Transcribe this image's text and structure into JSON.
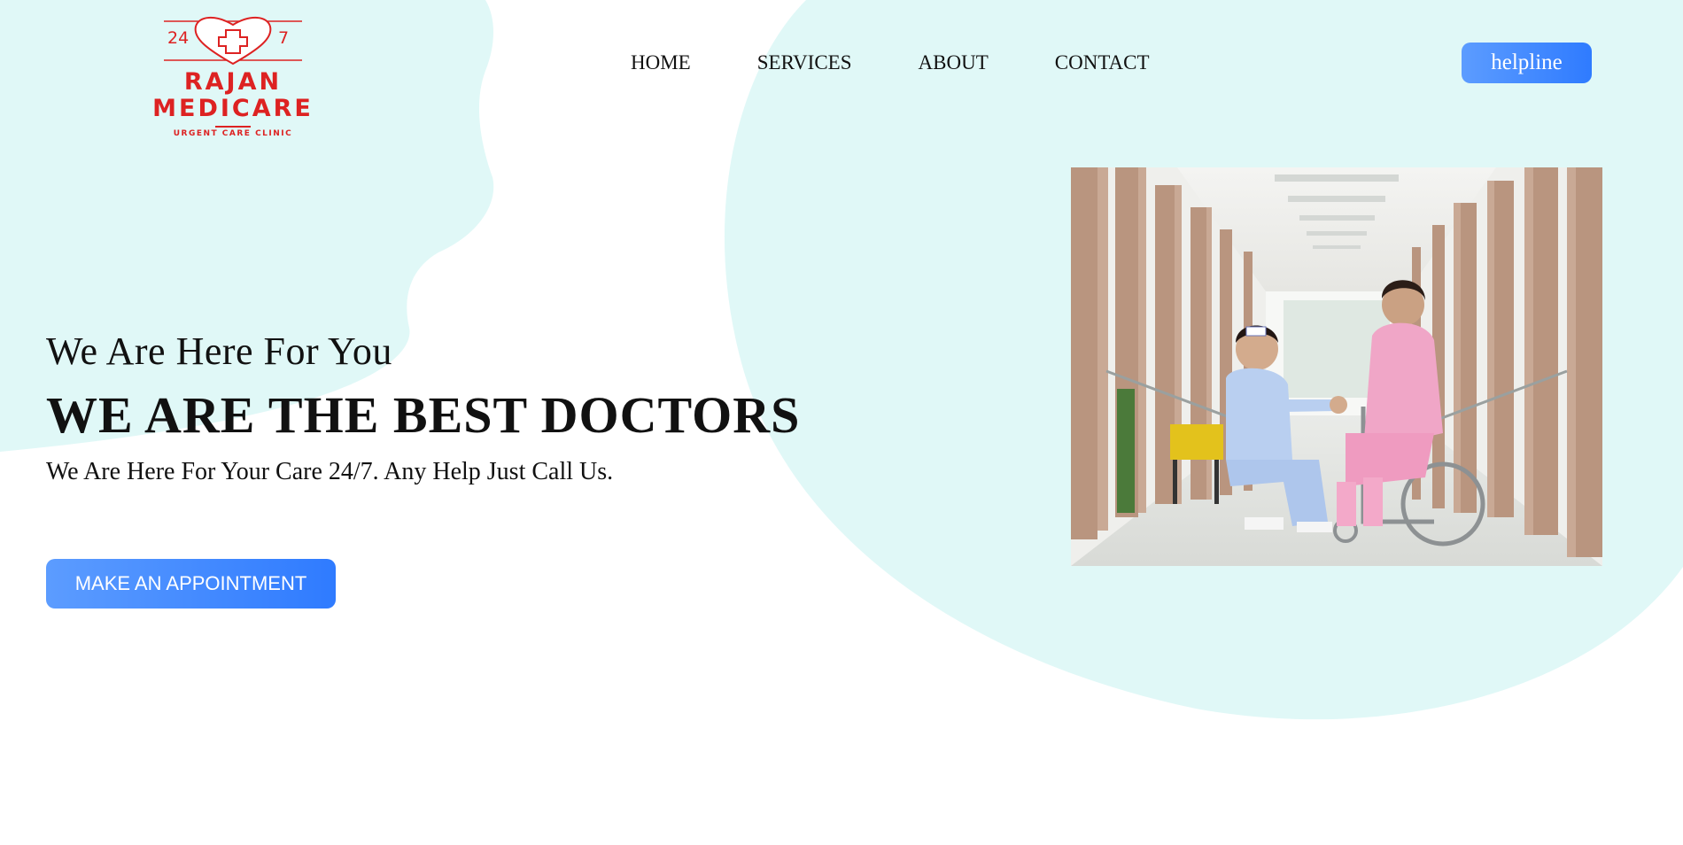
{
  "brand": {
    "badge_left": "24",
    "badge_right": "7",
    "name_line1": "RAJAN",
    "name_line2": "MEDICARE",
    "tagline": "URGENT CARE CLINIC"
  },
  "nav": {
    "items": [
      {
        "label": "HOME"
      },
      {
        "label": "SERVICES"
      },
      {
        "label": "ABOUT"
      },
      {
        "label": "CONTACT"
      }
    ]
  },
  "header": {
    "helpline_label": "helpline"
  },
  "hero": {
    "tagline": "We Are Here For You",
    "title": "WE ARE THE BEST DOCTORS",
    "subtitle": "We Are Here For Your Care 24/7. Any Help Just Call Us.",
    "cta_label": "MAKE AN APPOINTMENT"
  },
  "colors": {
    "background_blob": "#e0f8f7",
    "button_gradient_start": "#5c9cff",
    "button_gradient_end": "#2f7bff",
    "brand_red": "#dd2222"
  },
  "icons": {
    "logo": "heart-cross-icon",
    "photo": "nurse-with-patient-photo"
  }
}
